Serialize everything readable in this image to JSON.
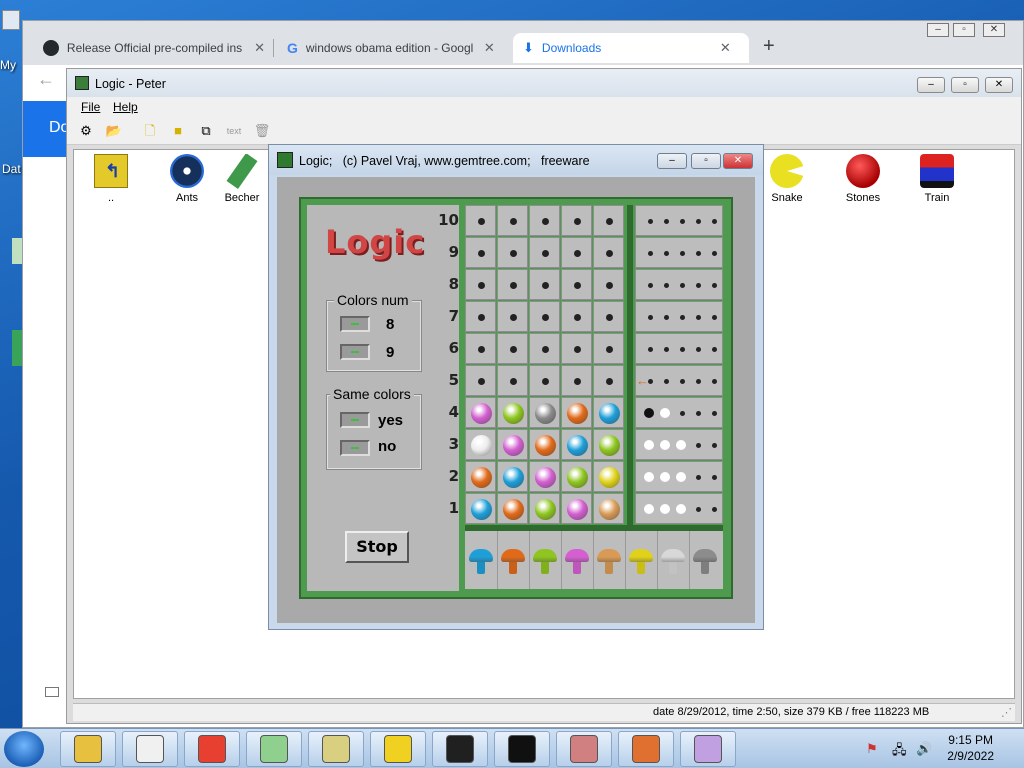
{
  "desktop": {
    "label_my": "My",
    "label_dat": "Dat"
  },
  "chrome": {
    "tabs": [
      {
        "title": "Release Official pre-compiled ins",
        "icon": "github-icon"
      },
      {
        "title": "windows obama edition - Googl",
        "icon": "google-icon"
      },
      {
        "title": "Downloads",
        "icon": "download-icon"
      }
    ],
    "new_tab": "+",
    "page_left_text": "Do"
  },
  "peter_window": {
    "title": "Logic - Peter",
    "menu": [
      "File",
      "Help"
    ],
    "toolbar_icons": [
      "tree-icon",
      "open-folder-icon",
      "new-file-icon",
      "folder-icon",
      "copy-icon",
      "text-icon",
      "trash-icon"
    ],
    "files": [
      {
        "label": "..",
        "icon": "parent-folder-icon"
      },
      {
        "label": "Ants",
        "icon": "ants-icon"
      },
      {
        "label": "Becher",
        "icon": "becher-icon"
      },
      {
        "label": "Snake",
        "icon": "snake-icon"
      },
      {
        "label": "Stones",
        "icon": "stones-icon"
      },
      {
        "label": "Train",
        "icon": "train-icon"
      }
    ],
    "status": "date 8/29/2012, time 2:50, size 379 KB / free 118223 MB"
  },
  "game": {
    "title": "Logic;   (c) Pavel Vraj, www.gemtree.com;   freeware",
    "logo": "Logic",
    "colors_num": {
      "label": "Colors num",
      "options": [
        "8",
        "9"
      ]
    },
    "same_colors": {
      "label": "Same colors",
      "options": [
        "yes",
        "no"
      ]
    },
    "stop_label": "Stop",
    "row_numbers": [
      "10",
      "9",
      "8",
      "7",
      "6",
      "5",
      "4",
      "3",
      "2",
      "1"
    ],
    "current_row": 5,
    "colors": {
      "magenta": "#d35fd0",
      "lime": "#8ec520",
      "gray": "#8a8a8a",
      "orange": "#e06a1a",
      "cyan": "#1e9fd8",
      "white": "#ececec",
      "yellow": "#e0d21a",
      "tan": "#d99a55",
      "silver": "#d8d8d8",
      "darkgray": "#8c8c8c"
    },
    "guesses": [
      {
        "row": 4,
        "balls": [
          "magenta",
          "lime",
          "gray",
          "orange",
          "cyan"
        ],
        "black": 1,
        "white": 1
      },
      {
        "row": 3,
        "balls": [
          "white",
          "magenta",
          "orange",
          "cyan",
          "lime"
        ],
        "black": 0,
        "white": 3
      },
      {
        "row": 2,
        "balls": [
          "orange",
          "cyan",
          "magenta",
          "lime",
          "yellow"
        ],
        "black": 0,
        "white": 3
      },
      {
        "row": 1,
        "balls": [
          "cyan",
          "orange",
          "lime",
          "magenta",
          "tan"
        ],
        "black": 0,
        "white": 3
      }
    ],
    "palette": [
      "cyan",
      "orange",
      "lime",
      "magenta",
      "tan",
      "yellow",
      "silver",
      "darkgray"
    ]
  },
  "taskbar": {
    "apps": [
      "explorer-icon",
      "media-player-icon",
      "chrome-icon",
      "bunny-game-icon",
      "alien-game-icon",
      "x-game-icon",
      "oscilloscope-icon",
      "cmd-icon",
      "cross-game-icon",
      "number-game-icon",
      "logic-game-icon"
    ],
    "time": "9:15 PM",
    "date": "2/9/2022"
  }
}
